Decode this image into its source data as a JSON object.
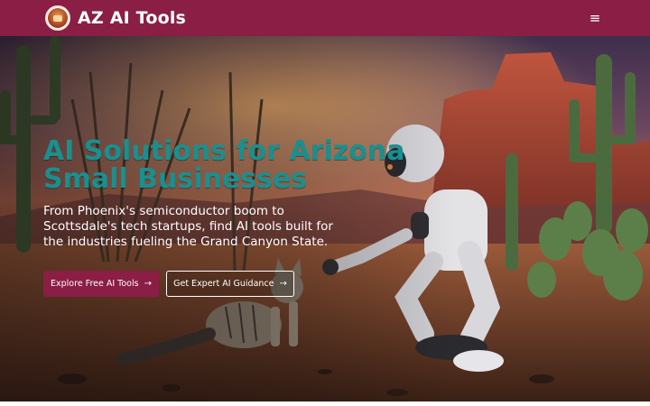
{
  "header": {
    "brand": "AZ AI Tools",
    "logo_icon": "arizona-ai-tools-logo-icon",
    "menu_icon": "hamburger-menu-icon",
    "menu_glyph": "≡",
    "background_color": "#8a1e44"
  },
  "hero": {
    "title_line1": "AI Solutions for Arizona",
    "title_line2": "Small Businesses",
    "subtitle": "From Phoenix's semiconductor boom to Scottsdale's tech startups, find AI tools built for the industries fueling the Grand Canyon State.",
    "primary_button": {
      "label": "Explore Free AI Tools",
      "icon": "arrow-right-icon",
      "glyph": "→"
    },
    "secondary_button": {
      "label": "Get Expert AI Guidance",
      "icon": "arrow-right-icon",
      "glyph": "→"
    },
    "image_description_icons": [
      "robot-icon",
      "cat-icon",
      "cactus-icon"
    ],
    "title_color": "#1a8f8f"
  }
}
